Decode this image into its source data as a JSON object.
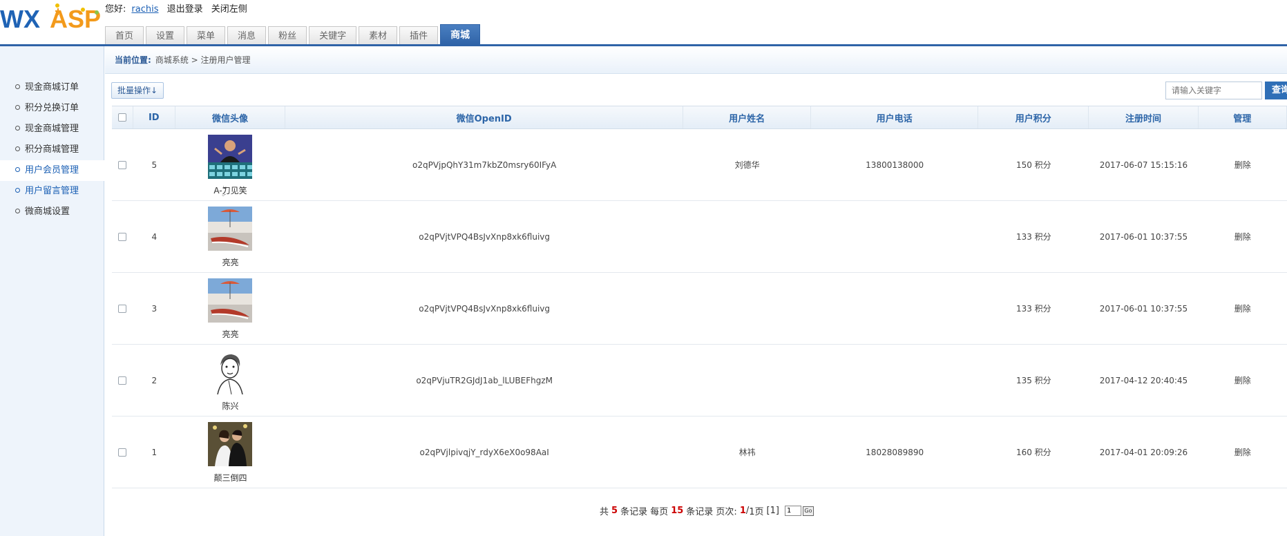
{
  "header": {
    "logo": "WXASP",
    "greeting": "您好:",
    "username": "rachis",
    "logout": "退出登录",
    "close_left": "关闭左侧",
    "tabs": [
      {
        "label": "首页"
      },
      {
        "label": "设置"
      },
      {
        "label": "菜单"
      },
      {
        "label": "消息"
      },
      {
        "label": "粉丝"
      },
      {
        "label": "关键字"
      },
      {
        "label": "素材"
      },
      {
        "label": "插件"
      },
      {
        "label": "商城",
        "active": true
      }
    ]
  },
  "sidebar": {
    "items": [
      {
        "label": "现金商城订单"
      },
      {
        "label": "积分兑换订单"
      },
      {
        "label": "现金商城管理"
      },
      {
        "label": "积分商城管理"
      },
      {
        "label": "用户会员管理",
        "active": true
      },
      {
        "label": "用户留言管理"
      },
      {
        "label": "微商城设置"
      }
    ]
  },
  "breadcrumb": {
    "label": "当前位置:",
    "path": "商城系统 > 注册用户管理"
  },
  "toolbar": {
    "batch_label": "批量操作↓",
    "search_placeholder": "请输入关键字",
    "search_button": "查询"
  },
  "table": {
    "headers": [
      "ID",
      "微信头像",
      "微信OpenID",
      "用户姓名",
      "用户电话",
      "用户积分",
      "注册时间",
      "管理"
    ],
    "rows": [
      {
        "id": "5",
        "nickname": "A-ۣۖ刀见笑",
        "openid": "o2qPVjpQhY31m7kbZ0msry60IFyA",
        "name": "刘德华",
        "phone": "13800138000",
        "points": "150 积分",
        "time": "2017-06-07 15:15:16",
        "action": "删除"
      },
      {
        "id": "4",
        "nickname": "亮亮",
        "openid": "o2qPVjtVPQ4BsJvXnp8xk6fluivg",
        "name": "",
        "phone": "",
        "points": "133 积分",
        "time": "2017-06-01 10:37:55",
        "action": "删除"
      },
      {
        "id": "3",
        "nickname": "亮亮",
        "openid": "o2qPVjtVPQ4BsJvXnp8xk6fluivg",
        "name": "",
        "phone": "",
        "points": "133 积分",
        "time": "2017-06-01 10:37:55",
        "action": "删除"
      },
      {
        "id": "2",
        "nickname": "陈兴",
        "openid": "o2qPVjuTR2GJdJ1ab_lLUBEFhgzM",
        "name": "",
        "phone": "",
        "points": "135 积分",
        "time": "2017-04-12 20:40:45",
        "action": "删除"
      },
      {
        "id": "1",
        "nickname": "颠三倒四",
        "openid": "o2qPVjlpivqjY_rdyX6eX0o98AaI",
        "name": "林祎",
        "phone": "18028089890",
        "points": "160 积分",
        "time": "2017-04-01 20:09:26",
        "action": "删除"
      }
    ]
  },
  "pager": {
    "total_prefix": "共",
    "total": "5",
    "total_suffix": "条记录 每页",
    "per_page": "15",
    "per_page_suffix": "条记录 页次:",
    "current": "1",
    "pages": "1页",
    "page_links": "[1]",
    "input_value": "1",
    "go_label": "Go"
  }
}
